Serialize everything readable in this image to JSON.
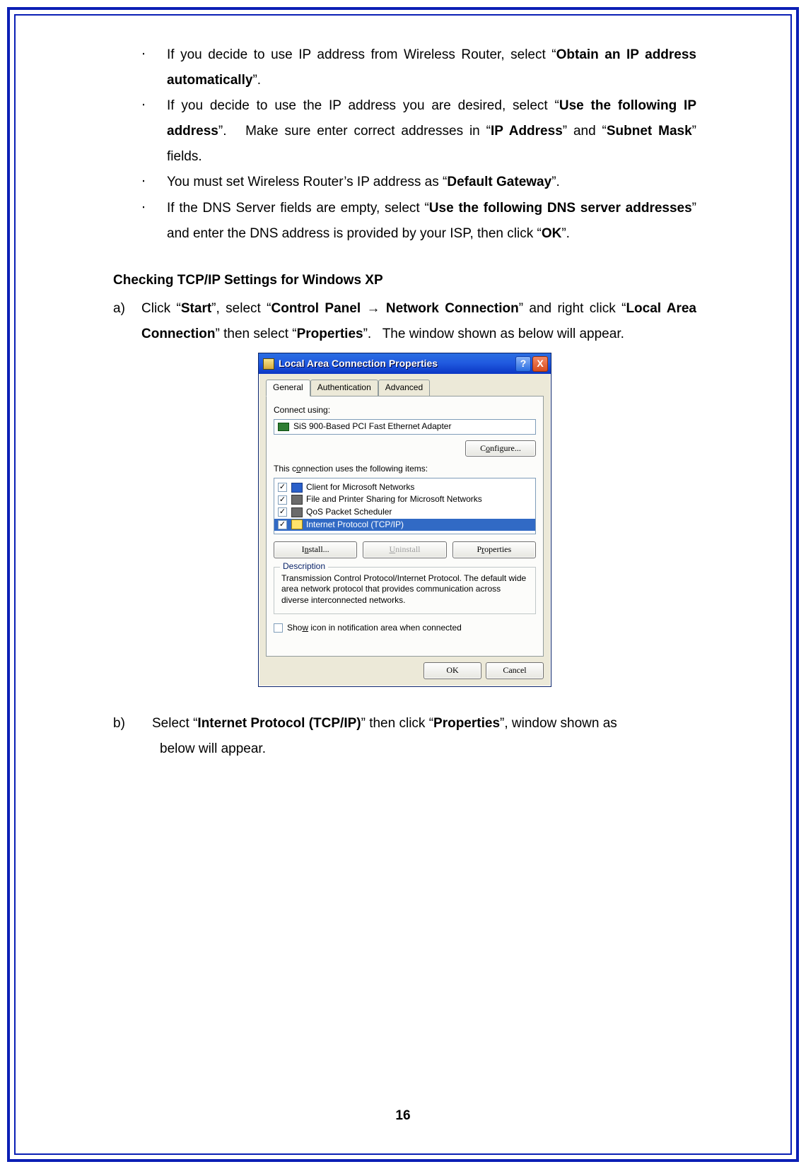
{
  "bullets": [
    {
      "pre": "If you decide to use IP address from Wireless Router, select “",
      "b1": "Obtain an IP address automatically",
      "post": "”."
    },
    {
      "pre": "If you decide to use the IP address you are desired, select “",
      "b1": "Use the following IP address",
      "mid": "”.   Make sure enter correct addresses in “",
      "b2": "IP Address",
      "mid2": "” and “",
      "b3": "Subnet Mask",
      "post": "” fields."
    },
    {
      "pre": "You must set Wireless Router’s IP address as “",
      "b1": "Default Gateway",
      "post": "”."
    },
    {
      "pre": "If the DNS Server fields are empty, select “",
      "b1": "Use the following DNS server addresses",
      "mid": "” and enter the DNS address is provided by your ISP, then click “",
      "b2": "OK",
      "post": "”."
    }
  ],
  "heading": "Checking TCP/IP Settings for Windows XP",
  "step_a": {
    "label": "a)",
    "t1": "Click “",
    "b1": "Start",
    "t2": "”, select “",
    "b2": "Control Panel ",
    "arrow": "→",
    "b3": " Network Connection",
    "t3": "” and right click “",
    "b4": "Local Area Connection",
    "t4": "” then select “",
    "b5": "Properties",
    "t5": "”.   The window shown as below will appear."
  },
  "dialog": {
    "title": "Local Area Connection Properties",
    "help": "?",
    "close": "X",
    "tabs": [
      "General",
      "Authentication",
      "Advanced"
    ],
    "connect_label": "Connect using:",
    "adapter": "SiS 900-Based PCI Fast Ethernet Adapter",
    "configure_pre": "C",
    "configure_u": "o",
    "configure_post": "nfigure...",
    "items_label_pre": "This c",
    "items_label_u": "o",
    "items_label_post": "nnection uses the following items:",
    "items": [
      {
        "checked": true,
        "icon": "blue",
        "text": "Client for Microsoft Networks",
        "selected": false
      },
      {
        "checked": true,
        "icon": "gray",
        "text": "File and Printer Sharing for Microsoft Networks",
        "selected": false
      },
      {
        "checked": true,
        "icon": "gray",
        "text": "QoS Packet Scheduler",
        "selected": false
      },
      {
        "checked": true,
        "icon": "tcp",
        "text": "Internet Protocol (TCP/IP)",
        "selected": true
      }
    ],
    "install_pre": "I",
    "install_u": "n",
    "install_post": "stall...",
    "uninstall_pre": "",
    "uninstall_u": "U",
    "uninstall_post": "ninstall",
    "props_pre": "P",
    "props_u": "r",
    "props_post": "operties",
    "desc_legend": "Description",
    "desc_text": "Transmission Control Protocol/Internet Protocol. The default wide area network protocol that provides communication across diverse interconnected networks.",
    "show_pre": "Sho",
    "show_u": "w",
    "show_post": " icon in notification area when connected",
    "ok": "OK",
    "cancel": "Cancel"
  },
  "step_b": {
    "label": "b)",
    "t1": "Select “",
    "b1": "Internet Protocol (TCP/IP)",
    "t2": "” then click “",
    "b2": "Properties",
    "t3": "”, window shown as",
    "cont": "below will appear."
  },
  "page_number": "16",
  "bullet_glyph": "‧"
}
